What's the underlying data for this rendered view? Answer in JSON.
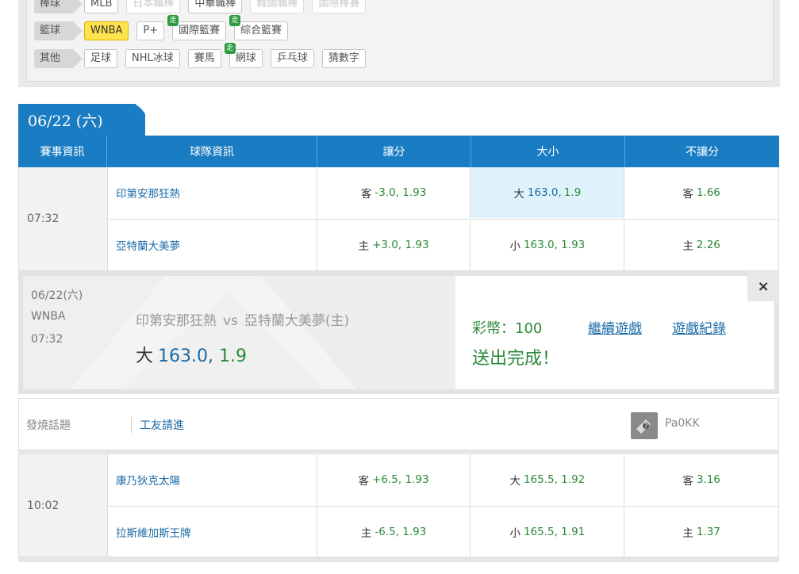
{
  "filters": {
    "rows": [
      {
        "label": "棒球",
        "chips": [
          {
            "text": "MLB",
            "faded": false,
            "active": false,
            "walk": false
          },
          {
            "text": "日本職棒",
            "faded": true,
            "active": false,
            "walk": false
          },
          {
            "text": "中華職棒",
            "faded": false,
            "active": false,
            "walk": false
          },
          {
            "text": "韓國職棒",
            "faded": true,
            "active": false,
            "walk": false
          },
          {
            "text": "國際棒賽",
            "faded": true,
            "active": false,
            "walk": false
          }
        ]
      },
      {
        "label": "籃球",
        "chips": [
          {
            "text": "WNBA",
            "faded": false,
            "active": true,
            "walk": false
          },
          {
            "text": "P+",
            "faded": false,
            "active": false,
            "walk": false
          },
          {
            "text": "國際籃賽",
            "faded": false,
            "active": false,
            "walk": true
          },
          {
            "text": "綜合籃賽",
            "faded": false,
            "active": false,
            "walk": true
          }
        ]
      },
      {
        "label": "其他",
        "chips": [
          {
            "text": "足球",
            "faded": false,
            "active": false,
            "walk": false
          },
          {
            "text": "NHL冰球",
            "faded": false,
            "active": false,
            "walk": false
          },
          {
            "text": "賽馬",
            "faded": false,
            "active": false,
            "walk": false
          },
          {
            "text": "網球",
            "faded": false,
            "active": false,
            "walk": true
          },
          {
            "text": "乒乓球",
            "faded": false,
            "active": false,
            "walk": false
          },
          {
            "text": "猜數字",
            "faded": false,
            "active": false,
            "walk": false
          }
        ]
      }
    ],
    "walk_badge": "走"
  },
  "date_tab": "06/22 (六)",
  "headers": [
    "賽事資訊",
    "球隊資訊",
    "讓分",
    "大小",
    "不讓分"
  ],
  "matches": [
    {
      "time": "07:32",
      "rows": [
        {
          "team": "印第安那狂熱",
          "spread_pre": "客",
          "spread": "-3.0, 1.93",
          "total_pre": "大",
          "total": "163.0, 1.9",
          "ml_pre": "客",
          "ml": "1.66"
        },
        {
          "team": "亞特蘭大美夢",
          "spread_pre": "主",
          "spread": "+3.0, 1.93",
          "total_pre": "小",
          "total": "163.0, 1.93",
          "ml_pre": "主",
          "ml": "2.26"
        }
      ]
    },
    {
      "time": "10:02",
      "rows": [
        {
          "team": "康乃狄克太陽",
          "spread_pre": "客",
          "spread": "+6.5, 1.93",
          "total_pre": "大",
          "total": "165.5, 1.92",
          "ml_pre": "客",
          "ml": "3.16"
        },
        {
          "team": "拉斯維加斯王牌",
          "spread_pre": "主",
          "spread": "-6.5, 1.93",
          "total_pre": "小",
          "total": "165.5, 1.91",
          "ml_pre": "主",
          "ml": "1.37"
        }
      ]
    }
  ],
  "confirmation": {
    "date": "06/22(六)",
    "league": "WNBA",
    "time": "07:32",
    "team_away": "印第安那狂熱",
    "vs": "vs",
    "team_home": "亞特蘭大美夢(主)",
    "bet_dir": "大",
    "bet_value": "163.0",
    "bet_sep": ",",
    "bet_odds": "1.9",
    "coins": "彩幣：100",
    "done": "送出完成！",
    "continue_link": "繼續遊戲",
    "history_link": "遊戲紀錄",
    "close": "×"
  },
  "discussion": {
    "label": "發燒話題",
    "topic": "工友請進",
    "user": "Pa0KK"
  },
  "colors": {
    "header_blue": "#1a7cc2",
    "odds_green": "#2c8a3a",
    "link_blue": "#1a6aa6",
    "highlight": "#dff2fb",
    "active_chip": "#ffe34d"
  }
}
